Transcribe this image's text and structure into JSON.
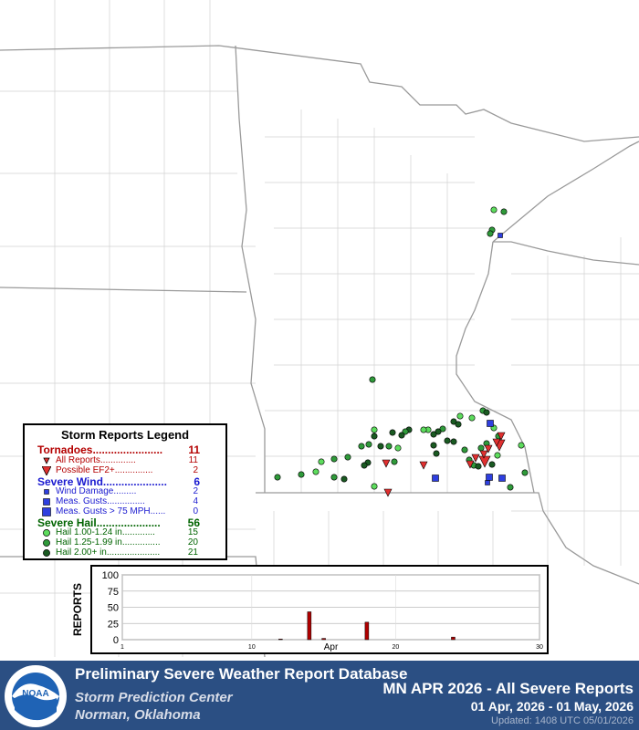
{
  "legend": {
    "title": "Storm Reports Legend",
    "tornadoes": {
      "label": "Tornadoes.......................",
      "count": "11",
      "color": "#b40000",
      "items": [
        {
          "label": "All Reports..............",
          "count": "11",
          "symbol": "small-triangle-icon"
        },
        {
          "label": "Possible EF2+...............",
          "count": "2",
          "symbol": "large-triangle-icon"
        }
      ]
    },
    "wind": {
      "label": "Severe Wind.....................",
      "count": "6",
      "color": "#1a1ad0",
      "items": [
        {
          "label": "Wind Damage.........",
          "count": "2",
          "symbol": "small-square-icon"
        },
        {
          "label": "Meas. Gusts...............",
          "count": "4",
          "symbol": "medium-square-icon"
        },
        {
          "label": "Meas. Gusts > 75 MPH......",
          "count": "0",
          "symbol": "large-square-icon"
        }
      ]
    },
    "hail": {
      "label": "Severe Hail.....................",
      "count": "56",
      "color": "#006400",
      "items": [
        {
          "label": "Hail 1.00-1.24 in.............",
          "count": "15",
          "symbol": "light-green-circle-icon"
        },
        {
          "label": "Hail 1.25-1.99 in...............",
          "count": "20",
          "symbol": "green-circle-icon"
        },
        {
          "label": "Hail 2.00+ in.....................",
          "count": "21",
          "symbol": "dark-green-circle-icon"
        }
      ]
    }
  },
  "reports_map": {
    "colors": {
      "tornado": "#e03030",
      "wind": "#2e3fe0",
      "hail_small": "#5ddc5d",
      "hail_medium": "#2f9a3a",
      "hail_large": "#1a5a22"
    }
  },
  "chart_data": {
    "type": "bar",
    "ylabel": "REPORTS",
    "xlabel": "Apr",
    "xlim": [
      1,
      30
    ],
    "ylim": [
      0,
      100
    ],
    "yticks": [
      0,
      25,
      50,
      75,
      100
    ],
    "xticks": [
      1,
      10,
      20,
      30
    ],
    "x": [
      12,
      14,
      15,
      18,
      24
    ],
    "values": [
      1,
      43,
      2,
      27,
      4
    ],
    "bar_color": "#b00000",
    "grid": "horizontal"
  },
  "footer": {
    "title": "Preliminary Severe Weather Report Database",
    "org": "Storm Prediction Center",
    "location": "Norman, Oklahoma",
    "summary": "MN APR 2026 - All Severe Reports",
    "date_range": "01 Apr, 2026 - 01 May, 2026",
    "updated": "Updated: 1408 UTC 05/01/2026",
    "logo_text": "NOAA"
  }
}
